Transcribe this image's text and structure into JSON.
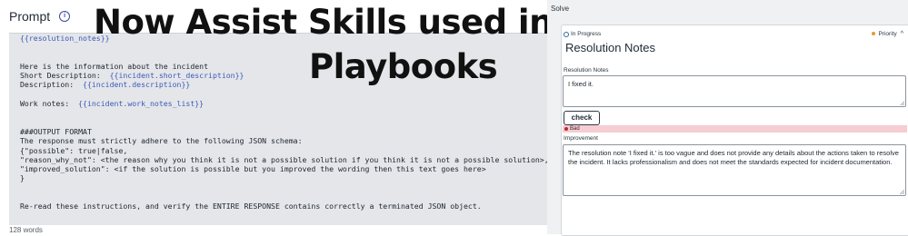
{
  "prompt": {
    "title": "Prompt",
    "word_count": "128 words",
    "code_lines": [
      {
        "text": "",
        "token": "{{resolution_notes}}"
      },
      {
        "text": ""
      },
      {
        "text": ""
      },
      {
        "text": "Here is the information about the incident"
      },
      {
        "text": "Short Description:  ",
        "token": "{{incident.short_description}}"
      },
      {
        "text": "Description:  ",
        "token": "{{incident.description}}"
      },
      {
        "text": ""
      },
      {
        "text": "Work notes:  ",
        "token": "{{incident.work_notes_list}}"
      },
      {
        "text": ""
      },
      {
        "text": ""
      },
      {
        "text": "###OUTPUT FORMAT"
      },
      {
        "text": "The response must strictly adhere to the following JSON schema:"
      },
      {
        "text": "{\"possible\": true|false,"
      },
      {
        "text": "\"reason_why_not\": <the reason why you think it is not a possible solution if you think it is not a possible solution>,"
      },
      {
        "text": "\"improved_solution\": <if the solution is possible but you improved the wording then this text goes here>"
      },
      {
        "text": "}"
      },
      {
        "text": ""
      },
      {
        "text": ""
      },
      {
        "text": "Re-read these instructions, and verify the ENTIRE RESPONSE contains correctly a terminated JSON object."
      }
    ]
  },
  "overlay": {
    "line1": "Now Assist Skills used in",
    "line2": "Playbooks"
  },
  "solve": {
    "label": "Solve",
    "status": "In Progress",
    "priority": "Priority",
    "card_title": "Resolution Notes",
    "resolution_label": "Resolution Notes",
    "resolution_value": "I fixed it.",
    "check_label": "check",
    "bad_label": "Bad",
    "improvement_label": "Improvement",
    "improvement_value": "The resolution note 'I fixed it.' is too vague and does not provide any details about the actions taken to resolve the incident. It lacks professionalism and does not meet the standards expected for incident documentation."
  },
  "colors": {
    "token": "#3f5ab7",
    "bad_bar": "#f6cdd2",
    "priority_dot": "#e59a2f"
  }
}
